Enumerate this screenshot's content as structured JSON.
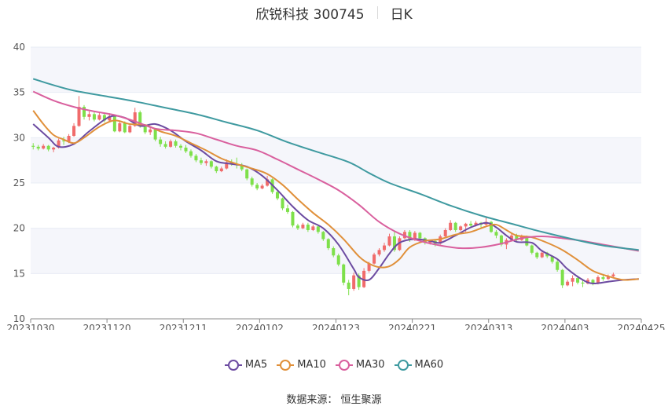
{
  "title": {
    "name": "欣锐科技 300745",
    "period": "日K"
  },
  "source": "数据来源： 恒生聚源",
  "colors": {
    "up": "#f06b6b",
    "down": "#7ee04a",
    "ma5": "#6c4ba1",
    "ma10": "#e0903a",
    "ma30": "#d9609e",
    "ma60": "#3f9aa0",
    "grid": "#e8ecf5",
    "band": "#f5f6fb"
  },
  "chart_data": {
    "type": "candlestick",
    "ylim": [
      10,
      40
    ],
    "yticks": [
      10,
      15,
      20,
      25,
      30,
      35,
      40
    ],
    "xtick_labels": [
      "20231030",
      "20231120",
      "20231211",
      "20240102",
      "20240123",
      "20240221",
      "20240313",
      "20240403",
      "20240425"
    ],
    "trading_days": 120,
    "ohlc": [
      [
        29.1,
        29.4,
        28.7,
        29.0
      ],
      [
        29.0,
        29.2,
        28.6,
        28.8
      ],
      [
        28.8,
        29.3,
        28.7,
        29.1
      ],
      [
        29.1,
        29.2,
        28.5,
        28.7
      ],
      [
        28.7,
        29.0,
        28.4,
        28.9
      ],
      [
        28.9,
        29.9,
        28.8,
        29.7
      ],
      [
        29.7,
        30.1,
        29.2,
        29.6
      ],
      [
        29.6,
        30.4,
        29.4,
        30.2
      ],
      [
        30.2,
        31.6,
        30.1,
        31.3
      ],
      [
        31.3,
        34.6,
        31.2,
        33.4
      ],
      [
        33.4,
        33.6,
        32.0,
        32.3
      ],
      [
        32.3,
        32.9,
        31.9,
        32.6
      ],
      [
        32.6,
        32.8,
        31.8,
        32.0
      ],
      [
        32.0,
        32.8,
        31.9,
        32.5
      ],
      [
        32.5,
        32.7,
        31.7,
        31.9
      ],
      [
        31.9,
        32.7,
        31.8,
        32.4
      ],
      [
        32.4,
        32.5,
        30.6,
        30.7
      ],
      [
        30.7,
        31.9,
        30.6,
        31.6
      ],
      [
        31.6,
        31.8,
        30.5,
        30.6
      ],
      [
        30.6,
        31.5,
        30.5,
        31.3
      ],
      [
        31.3,
        33.3,
        31.2,
        32.8
      ],
      [
        32.8,
        33.0,
        31.1,
        31.3
      ],
      [
        31.3,
        31.5,
        30.4,
        30.6
      ],
      [
        30.6,
        31.1,
        30.3,
        30.9
      ],
      [
        30.9,
        31.0,
        29.6,
        29.8
      ],
      [
        29.8,
        30.1,
        29.0,
        29.3
      ],
      [
        29.3,
        29.6,
        28.8,
        29.0
      ],
      [
        29.0,
        29.8,
        28.9,
        29.6
      ],
      [
        29.6,
        29.8,
        28.9,
        29.1
      ],
      [
        29.1,
        29.3,
        28.6,
        28.9
      ],
      [
        28.9,
        29.2,
        28.3,
        28.5
      ],
      [
        28.5,
        28.7,
        27.8,
        28.0
      ],
      [
        28.0,
        28.2,
        27.3,
        27.5
      ],
      [
        27.5,
        27.8,
        27.0,
        27.2
      ],
      [
        27.2,
        27.6,
        26.9,
        27.4
      ],
      [
        27.4,
        27.5,
        26.6,
        26.8
      ],
      [
        26.8,
        26.9,
        26.1,
        26.3
      ],
      [
        26.3,
        26.8,
        26.2,
        26.6
      ],
      [
        26.6,
        27.6,
        26.5,
        27.3
      ],
      [
        27.3,
        27.6,
        26.9,
        27.1
      ],
      [
        27.1,
        27.8,
        26.6,
        27.0
      ],
      [
        27.0,
        27.2,
        26.3,
        26.5
      ],
      [
        26.5,
        26.6,
        25.3,
        25.5
      ],
      [
        25.5,
        25.7,
        24.6,
        24.8
      ],
      [
        24.8,
        25.0,
        24.2,
        24.4
      ],
      [
        24.4,
        24.9,
        24.3,
        24.7
      ],
      [
        24.7,
        25.8,
        24.6,
        25.4
      ],
      [
        25.4,
        25.5,
        23.8,
        24.0
      ],
      [
        24.0,
        24.2,
        23.1,
        23.3
      ],
      [
        23.3,
        23.4,
        22.0,
        22.2
      ],
      [
        22.2,
        22.6,
        21.6,
        21.8
      ],
      [
        21.8,
        21.9,
        20.1,
        20.3
      ],
      [
        20.3,
        20.5,
        19.8,
        20.0
      ],
      [
        20.0,
        20.6,
        19.9,
        20.4
      ],
      [
        20.4,
        20.6,
        19.6,
        19.8
      ],
      [
        19.8,
        20.4,
        19.7,
        20.2
      ],
      [
        20.2,
        20.3,
        19.4,
        19.6
      ],
      [
        19.6,
        19.7,
        18.6,
        18.8
      ],
      [
        18.8,
        18.9,
        17.6,
        17.8
      ],
      [
        17.8,
        18.0,
        16.8,
        17.0
      ],
      [
        17.0,
        17.2,
        15.8,
        16.0
      ],
      [
        16.0,
        16.1,
        13.7,
        14.0
      ],
      [
        14.0,
        14.3,
        12.6,
        13.3
      ],
      [
        13.3,
        15.1,
        13.1,
        14.8
      ],
      [
        14.8,
        15.0,
        13.2,
        13.5
      ],
      [
        13.5,
        15.6,
        13.4,
        15.3
      ],
      [
        15.3,
        16.3,
        15.1,
        16.1
      ],
      [
        16.1,
        17.3,
        16.0,
        17.1
      ],
      [
        17.1,
        17.8,
        16.9,
        17.6
      ],
      [
        17.6,
        18.4,
        17.4,
        18.1
      ],
      [
        18.1,
        19.4,
        18.0,
        19.1
      ],
      [
        19.1,
        19.7,
        17.4,
        17.6
      ],
      [
        17.6,
        19.1,
        17.5,
        18.9
      ],
      [
        18.9,
        19.8,
        18.8,
        19.6
      ],
      [
        19.6,
        19.8,
        18.5,
        18.7
      ],
      [
        18.7,
        19.7,
        18.6,
        19.5
      ],
      [
        19.5,
        19.6,
        18.7,
        18.9
      ],
      [
        18.9,
        19.0,
        18.2,
        18.4
      ],
      [
        18.4,
        18.7,
        18.2,
        18.6
      ],
      [
        18.6,
        18.8,
        18.0,
        18.3
      ],
      [
        18.3,
        19.3,
        18.2,
        19.1
      ],
      [
        19.1,
        20.0,
        19.0,
        19.8
      ],
      [
        19.8,
        20.9,
        19.7,
        20.6
      ],
      [
        20.6,
        20.7,
        19.6,
        19.8
      ],
      [
        19.8,
        20.3,
        19.7,
        20.2
      ],
      [
        20.2,
        20.6,
        19.6,
        20.5
      ],
      [
        20.5,
        20.8,
        20.1,
        20.3
      ],
      [
        20.3,
        20.8,
        20.2,
        20.6
      ],
      [
        20.6,
        20.7,
        20.1,
        20.4
      ],
      [
        20.4,
        21.2,
        20.3,
        20.7
      ],
      [
        20.7,
        20.8,
        19.5,
        19.6
      ],
      [
        19.6,
        19.8,
        18.9,
        19.2
      ],
      [
        19.2,
        19.3,
        18.0,
        18.2
      ],
      [
        18.2,
        18.9,
        17.7,
        18.7
      ],
      [
        18.7,
        19.5,
        18.6,
        19.2
      ],
      [
        19.2,
        19.4,
        18.5,
        18.7
      ],
      [
        18.7,
        19.3,
        18.6,
        19.1
      ],
      [
        19.1,
        19.2,
        18.0,
        18.1
      ],
      [
        18.1,
        18.2,
        17.1,
        17.3
      ],
      [
        17.3,
        17.4,
        16.6,
        16.8
      ],
      [
        16.8,
        17.6,
        16.7,
        17.3
      ],
      [
        17.3,
        17.4,
        16.7,
        16.9
      ],
      [
        16.9,
        17.0,
        16.1,
        16.3
      ],
      [
        16.3,
        16.5,
        15.2,
        15.4
      ],
      [
        15.4,
        15.5,
        13.4,
        13.7
      ],
      [
        13.7,
        14.3,
        13.6,
        14.1
      ],
      [
        14.1,
        14.8,
        13.6,
        14.5
      ],
      [
        14.5,
        14.6,
        13.8,
        14.0
      ],
      [
        14.0,
        14.3,
        13.5,
        13.9
      ],
      [
        13.9,
        14.5,
        13.8,
        14.3
      ],
      [
        14.3,
        14.4,
        13.7,
        13.9
      ],
      [
        13.9,
        14.8,
        13.8,
        14.6
      ],
      [
        14.6,
        14.9,
        14.2,
        14.4
      ],
      [
        14.4,
        14.9,
        14.3,
        14.7
      ],
      [
        14.7,
        15.1,
        14.5,
        14.9
      ]
    ],
    "series": [
      {
        "name": "MA5",
        "values": [
          [
            0,
            31.5
          ],
          [
            3,
            30.0
          ],
          [
            5,
            29.0
          ],
          [
            8,
            29.3
          ],
          [
            11,
            30.7
          ],
          [
            15,
            32.3
          ],
          [
            18,
            32.2
          ],
          [
            21,
            31.3
          ],
          [
            24,
            31.5
          ],
          [
            27,
            30.8
          ],
          [
            30,
            29.6
          ],
          [
            33,
            28.6
          ],
          [
            36,
            27.4
          ],
          [
            39,
            27.1
          ],
          [
            42,
            26.8
          ],
          [
            45,
            25.8
          ],
          [
            48,
            24.2
          ],
          [
            51,
            22.4
          ],
          [
            54,
            20.9
          ],
          [
            57,
            20.0
          ],
          [
            60,
            18.2
          ],
          [
            63,
            15.5
          ],
          [
            64,
            14.6
          ],
          [
            66,
            14.3
          ],
          [
            68,
            15.6
          ],
          [
            70,
            17.2
          ],
          [
            72,
            18.4
          ],
          [
            75,
            18.8
          ],
          [
            78,
            18.6
          ],
          [
            80,
            18.4
          ],
          [
            83,
            19.2
          ],
          [
            86,
            20.1
          ],
          [
            89,
            20.6
          ],
          [
            91,
            20.1
          ],
          [
            93,
            19.2
          ],
          [
            95,
            18.5
          ],
          [
            98,
            18.4
          ],
          [
            100,
            17.5
          ],
          [
            103,
            16.6
          ],
          [
            105,
            15.5
          ],
          [
            108,
            14.3
          ],
          [
            110,
            13.9
          ],
          [
            113,
            14.1
          ],
          [
            116,
            14.3
          ],
          [
            119,
            14.4
          ]
        ]
      },
      {
        "name": "MA10",
        "values": [
          [
            0,
            33.0
          ],
          [
            2,
            31.5
          ],
          [
            4,
            30.3
          ],
          [
            6,
            29.8
          ],
          [
            8,
            29.4
          ],
          [
            10,
            30.0
          ],
          [
            13,
            31.2
          ],
          [
            16,
            31.9
          ],
          [
            19,
            31.5
          ],
          [
            22,
            31.4
          ],
          [
            25,
            30.7
          ],
          [
            28,
            30.2
          ],
          [
            31,
            29.4
          ],
          [
            34,
            28.6
          ],
          [
            37,
            27.7
          ],
          [
            40,
            27.1
          ],
          [
            43,
            26.6
          ],
          [
            46,
            26.0
          ],
          [
            49,
            24.8
          ],
          [
            52,
            23.2
          ],
          [
            55,
            21.7
          ],
          [
            58,
            20.4
          ],
          [
            61,
            18.8
          ],
          [
            64,
            16.9
          ],
          [
            66,
            16.1
          ],
          [
            68,
            15.7
          ],
          [
            70,
            15.8
          ],
          [
            72,
            16.6
          ],
          [
            74,
            17.9
          ],
          [
            77,
            18.6
          ],
          [
            80,
            18.8
          ],
          [
            83,
            19.3
          ],
          [
            86,
            19.6
          ],
          [
            89,
            20.2
          ],
          [
            91,
            20.4
          ],
          [
            93,
            19.8
          ],
          [
            95,
            19.2
          ],
          [
            98,
            19.0
          ],
          [
            101,
            18.4
          ],
          [
            104,
            17.6
          ],
          [
            107,
            16.5
          ],
          [
            110,
            15.3
          ],
          [
            113,
            14.7
          ],
          [
            116,
            14.3
          ],
          [
            119,
            14.4
          ]
        ]
      },
      {
        "name": "MA30",
        "values": [
          [
            0,
            35.1
          ],
          [
            4,
            34.1
          ],
          [
            8,
            33.4
          ],
          [
            12,
            32.9
          ],
          [
            16,
            32.5
          ],
          [
            20,
            31.8
          ],
          [
            24,
            31.0
          ],
          [
            28,
            30.8
          ],
          [
            32,
            30.5
          ],
          [
            36,
            29.8
          ],
          [
            40,
            29.1
          ],
          [
            44,
            28.6
          ],
          [
            48,
            27.6
          ],
          [
            52,
            26.5
          ],
          [
            56,
            25.4
          ],
          [
            60,
            24.2
          ],
          [
            64,
            22.6
          ],
          [
            68,
            20.7
          ],
          [
            72,
            19.4
          ],
          [
            76,
            18.6
          ],
          [
            80,
            18.1
          ],
          [
            84,
            17.8
          ],
          [
            88,
            17.9
          ],
          [
            92,
            18.3
          ],
          [
            96,
            18.9
          ],
          [
            100,
            19.1
          ],
          [
            104,
            18.9
          ],
          [
            108,
            18.6
          ],
          [
            112,
            18.2
          ],
          [
            116,
            17.8
          ],
          [
            119,
            17.5
          ]
        ]
      },
      {
        "name": "MA60",
        "values": [
          [
            0,
            36.5
          ],
          [
            4,
            35.8
          ],
          [
            8,
            35.2
          ],
          [
            14,
            34.6
          ],
          [
            20,
            34.0
          ],
          [
            26,
            33.3
          ],
          [
            32,
            32.6
          ],
          [
            38,
            31.7
          ],
          [
            44,
            30.8
          ],
          [
            50,
            29.5
          ],
          [
            56,
            28.4
          ],
          [
            62,
            27.3
          ],
          [
            66,
            26.1
          ],
          [
            70,
            25.0
          ],
          [
            76,
            23.8
          ],
          [
            82,
            22.5
          ],
          [
            88,
            21.4
          ],
          [
            94,
            20.5
          ],
          [
            100,
            19.6
          ],
          [
            106,
            18.8
          ],
          [
            112,
            18.1
          ],
          [
            119,
            17.6
          ]
        ]
      }
    ],
    "legend": [
      "MA5",
      "MA10",
      "MA30",
      "MA60"
    ],
    "legend_position": "bottom",
    "grid": true
  }
}
